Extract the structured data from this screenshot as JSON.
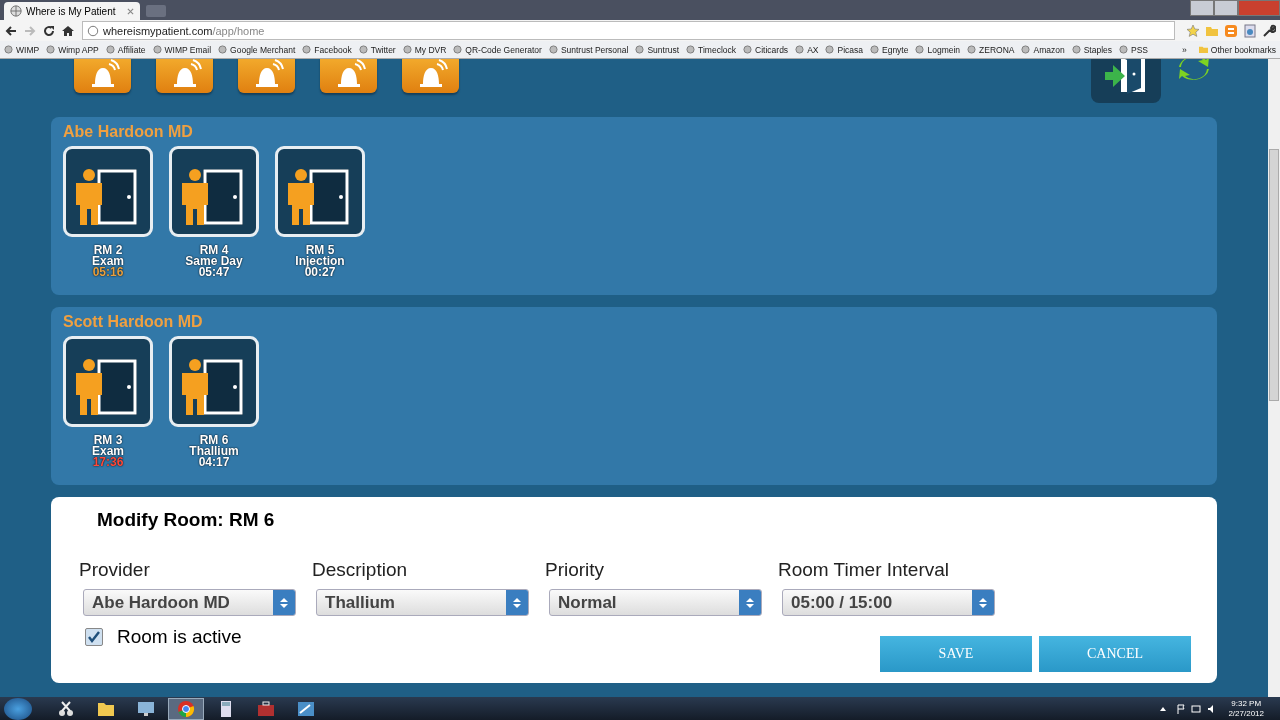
{
  "browser": {
    "tab_title": "Where is My Patient",
    "url_host": "whereismypatient.com",
    "url_path": "/app/home",
    "bookmarks": [
      "WIMP",
      "Wimp APP",
      "Affiliate",
      "WIMP Email",
      "Google Merchant",
      "Facebook",
      "Twitter",
      "My DVR",
      "QR-Code Generator",
      "Suntrust Personal",
      "Suntrust",
      "Timeclock",
      "Citicards",
      "AX",
      "Picasa",
      "Egnyte",
      "Logmein",
      "ZERONA",
      "Amazon",
      "Staples",
      "PSS"
    ],
    "overflow": "»",
    "other_bookmarks": "Other bookmarks"
  },
  "alert_buttons": [
    {
      "kind": "bell"
    },
    {
      "kind": "bell"
    },
    {
      "kind": "bell"
    },
    {
      "kind": "bell"
    },
    {
      "kind": "bell"
    }
  ],
  "providers": [
    {
      "name": "Abe Hardoon MD",
      "rooms": [
        {
          "room": "RM 2",
          "description": "Exam",
          "timer": "05:16",
          "color": "#e8a040"
        },
        {
          "room": "RM 4",
          "description": "Same Day",
          "timer": "05:47",
          "color": "#ffffff"
        },
        {
          "room": "RM 5",
          "description": "Injection",
          "timer": "00:27",
          "color": "#ffffff"
        }
      ]
    },
    {
      "name": "Scott Hardoon MD",
      "rooms": [
        {
          "room": "RM 3",
          "description": "Exam",
          "timer": "17:36",
          "color": "#ff4a3a"
        },
        {
          "room": "RM 6",
          "description": "Thallium",
          "timer": "04:17",
          "color": "#ffffff"
        }
      ]
    }
  ],
  "modify": {
    "title": "Modify Room: RM 6",
    "fields": [
      {
        "label": "Provider",
        "value": "Abe Hardoon MD"
      },
      {
        "label": "Description",
        "value": "Thallium"
      },
      {
        "label": "Priority",
        "value": "Normal"
      },
      {
        "label": "Room Timer Interval",
        "value": "05:00 / 15:00"
      }
    ],
    "active": {
      "label": "Room is active",
      "checked": true
    },
    "buttons": [
      "SAVE",
      "CANCEL"
    ]
  },
  "taskbar": {
    "apps": [
      {
        "kind": "scissors",
        "selected": false
      },
      {
        "kind": "folder",
        "selected": false
      },
      {
        "kind": "monitor",
        "selected": false
      },
      {
        "kind": "chrome",
        "selected": true
      },
      {
        "kind": "calculator",
        "selected": false
      },
      {
        "kind": "case",
        "selected": false
      },
      {
        "kind": "window",
        "selected": false
      }
    ],
    "time": "9:32 PM",
    "date": "2/27/2012"
  }
}
